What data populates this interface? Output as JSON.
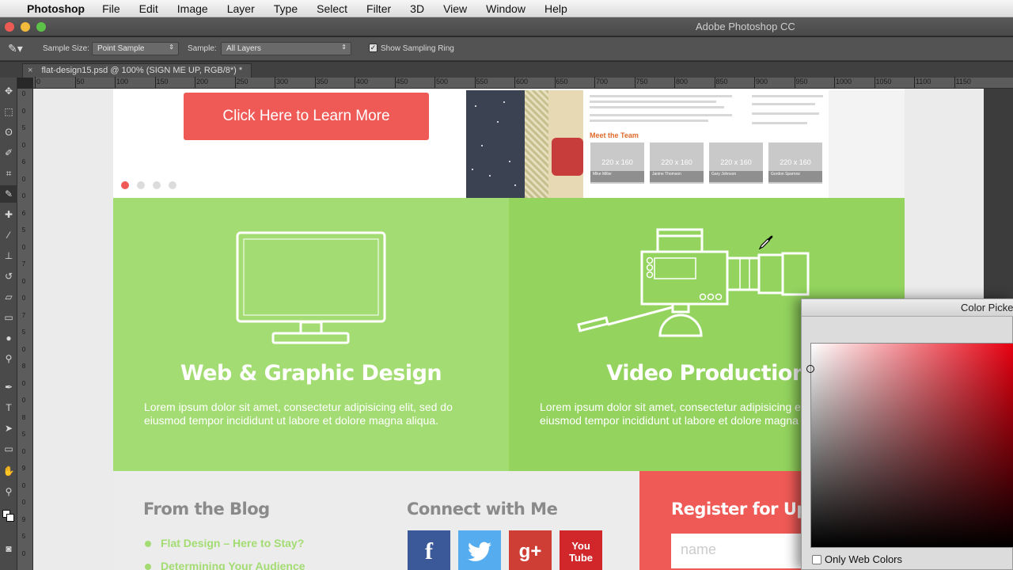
{
  "menubar": {
    "app_name": "Photoshop",
    "items": [
      "File",
      "Edit",
      "Image",
      "Layer",
      "Type",
      "Select",
      "Filter",
      "3D",
      "View",
      "Window",
      "Help"
    ]
  },
  "window": {
    "title": "Adobe Photoshop CC"
  },
  "options": {
    "sample_size_label": "Sample Size:",
    "sample_size_value": "Point Sample",
    "sample_label": "Sample:",
    "sample_value": "All Layers",
    "sampling_ring_label": "Show Sampling Ring",
    "sampling_ring_checked": true
  },
  "document_tab": {
    "title": "flat-design15.psd @ 100% (SIGN ME UP, RGB/8*) *"
  },
  "ruler_top": [
    "0",
    "50",
    "100",
    "150",
    "200",
    "250",
    "300",
    "350",
    "400",
    "450",
    "500",
    "550",
    "600",
    "650",
    "700",
    "750",
    "800",
    "850",
    "900",
    "950",
    "1000",
    "1050",
    "1100",
    "1150"
  ],
  "ruler_left": [
    "0",
    "0",
    "5",
    "0",
    "6",
    "0",
    "0",
    "6",
    "5",
    "0",
    "7",
    "0",
    "0",
    "7",
    "5",
    "0",
    "8",
    "0",
    "0",
    "8",
    "5",
    "0",
    "9",
    "0",
    "0",
    "9",
    "5",
    "0"
  ],
  "design": {
    "cta_label": "Click Here to Learn More",
    "slider_dots": 4,
    "meet_team": "Meet the Team",
    "team_cards": [
      {
        "size": "220 x 160",
        "name": "Mike Miller"
      },
      {
        "size": "220 x 160",
        "name": "Janine Thomson"
      },
      {
        "size": "220 x 160",
        "name": "Gary Johnson"
      },
      {
        "size": "220 x 160",
        "name": "Gordon Sparrow"
      }
    ],
    "services": [
      {
        "title": "Web & Graphic Design",
        "text": "Lorem ipsum dolor sit amet, consectetur adipisicing elit, sed do eiusmod tempor incididunt ut labore et dolore magna aliqua."
      },
      {
        "title": "Video Production",
        "text": "Lorem ipsum dolor sit amet, consectetur adipisicing elit, sed do eiusmod tempor incididunt ut labore et dolore magna aliqua."
      }
    ],
    "blog_title": "From the Blog",
    "blog_items": [
      "Flat Design – Here to Stay?",
      "Determining Your Audience"
    ],
    "connect_title": "Connect with Me",
    "social": [
      {
        "name": "facebook",
        "label": "f",
        "color": "#3b5998"
      },
      {
        "name": "twitter",
        "label": "🐦",
        "color": "#55acee"
      },
      {
        "name": "google-plus",
        "label": "g+",
        "color": "#cf3e35"
      },
      {
        "name": "youtube",
        "label": "You Tube",
        "color": "#d1272a"
      }
    ],
    "register_title": "Register for Updates",
    "name_placeholder": "name",
    "colors": {
      "accent_red": "#ef5a56",
      "green_light": "#a3dc72",
      "green_dark": "#93d35e"
    }
  },
  "color_picker": {
    "title": "Color Picker",
    "only_web_colors_label": "Only Web Colors",
    "only_web_colors_checked": false
  }
}
